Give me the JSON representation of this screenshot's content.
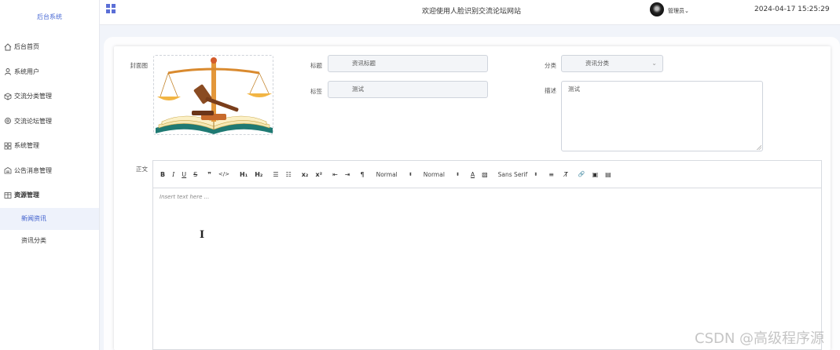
{
  "sidebar": {
    "brand": "后台系统",
    "items": [
      {
        "label": "后台首页",
        "icon": "home-icon"
      },
      {
        "label": "系统用户",
        "icon": "user-icon"
      },
      {
        "label": "交流分类管理",
        "icon": "box-icon"
      },
      {
        "label": "交流论坛管理",
        "icon": "gear-icon"
      },
      {
        "label": "系统管理",
        "icon": "grid-icon"
      },
      {
        "label": "公告消息管理",
        "icon": "notice-icon"
      },
      {
        "label": "资源管理",
        "icon": "table-icon"
      }
    ],
    "sub_items": [
      {
        "label": "新闻资讯",
        "active": true
      },
      {
        "label": "资讯分类",
        "active": false
      }
    ]
  },
  "topbar": {
    "welcome": "欢迎使用人脸识别交流论坛网站",
    "user": "管理员",
    "datetime": "2024-04-17 15:25:29"
  },
  "form": {
    "cover_label": "封面图",
    "title_label": "标题",
    "title_value": "资讯标题",
    "tag_label": "标签",
    "tag_value": "测试",
    "category_label": "分类",
    "category_value": "资讯分类",
    "desc_label": "描述",
    "desc_value": "测试",
    "body_label": "正文"
  },
  "editor": {
    "buttons": [
      "B",
      "I",
      "U",
      "S",
      "❞",
      "</>",
      "H₁",
      "H₂",
      "☰",
      "☷",
      "x₂",
      "x²",
      "⇤",
      "⇥",
      "¶",
      "A",
      "▧",
      "T̸",
      "🔗",
      "▣",
      "▤"
    ],
    "selects": [
      "Normal",
      "Normal",
      "Sans Serif"
    ],
    "placeholder": "Insert text here ..."
  },
  "watermark": "CSDN @高级程序源",
  "colors": {
    "accent": "#3b5ccc",
    "sidebar_active_bg": "#eef2fb",
    "page_bg": "#f1f4fa"
  }
}
